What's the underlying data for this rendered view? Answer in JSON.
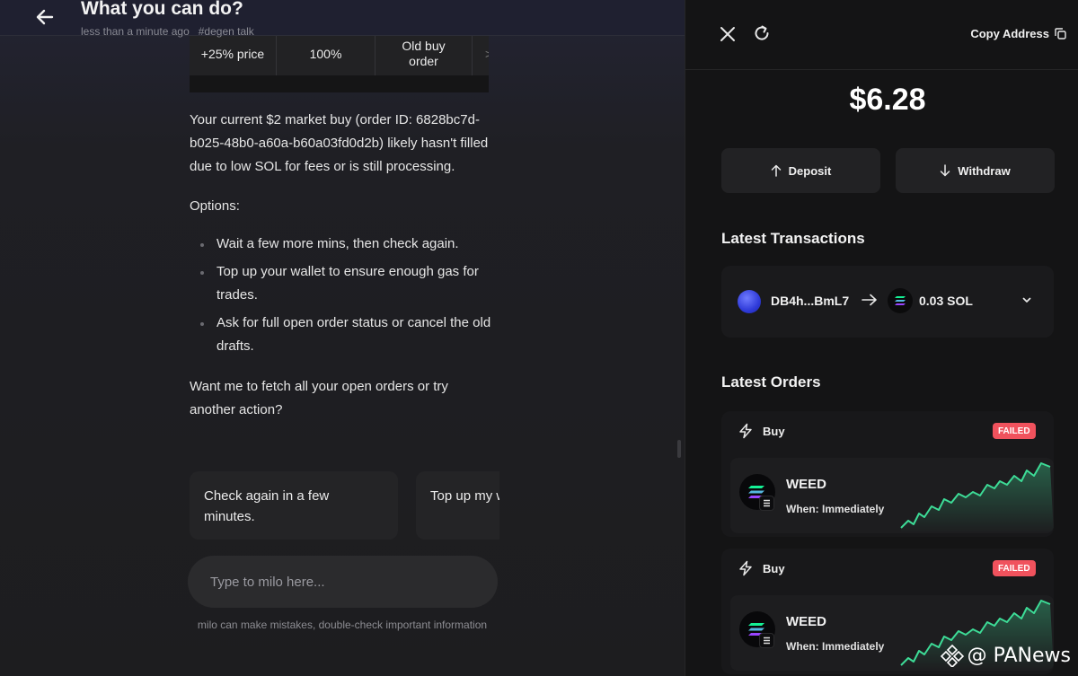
{
  "header": {
    "title": "What you can do?",
    "time": "less than a minute ago",
    "tag": "#degen talk"
  },
  "options_table": {
    "cells": [
      "+25% price",
      "100%",
      "Old buy order",
      ">"
    ]
  },
  "chat": {
    "message": "Your current $2 market buy (order ID: 6828bc7d-b025-48b0-a60a-b60a03fd0d2b) likely hasn't filled due to low SOL for fees or is still processing.",
    "options_label": "Options:",
    "options": [
      "Wait a few more mins, then check again.",
      "Top up your wallet to ensure enough gas for trades.",
      "Ask for full open order status or cancel the old drafts."
    ],
    "followup": "Want me to fetch all your open orders or try another action?",
    "suggestions": [
      "Check again in a few minutes.",
      "Top up my wallet"
    ],
    "input_placeholder": "Type to milo here...",
    "disclaimer": "milo can make mistakes, double-check important information"
  },
  "wallet": {
    "copy_label": "Copy Address",
    "balance": "$6.28",
    "deposit_label": "Deposit",
    "withdraw_label": "Withdraw",
    "transactions_title": "Latest Transactions",
    "transaction": {
      "from": "DB4h...BmL7",
      "amount": "0.03 SOL"
    },
    "orders_title": "Latest Orders",
    "orders": [
      {
        "type": "Buy",
        "status": "FAILED",
        "token": "WEED",
        "when": "When: Immediately"
      },
      {
        "type": "Buy",
        "status": "FAILED",
        "token": "WEED",
        "when": "When: Immediately"
      }
    ]
  },
  "colors": {
    "accent_green": "#3ddc97",
    "failed_red": "#f0525d"
  },
  "watermark": "@ PANews"
}
